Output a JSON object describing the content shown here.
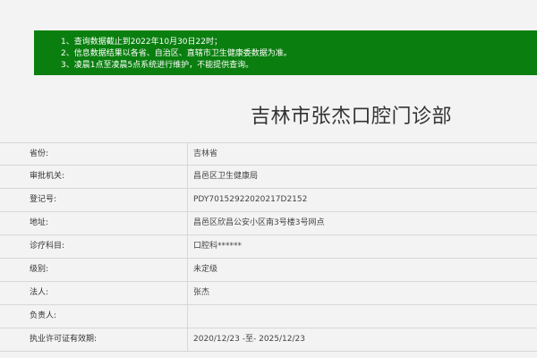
{
  "notice": {
    "lines": [
      "1、查询数据截止到2022年10月30日22时；",
      "2、信息数据结果以各省、自治区、直辖市卫生健康委数据为准。",
      "3、凌晨1点至凌晨5点系统进行维护，不能提供查询。"
    ]
  },
  "title": "吉林市张杰口腔门诊部",
  "rows": [
    {
      "label": "省份:",
      "value": "吉林省"
    },
    {
      "label": "审批机关:",
      "value": "昌邑区卫生健康局"
    },
    {
      "label": "登记号:",
      "value": "PDY70152922020217D2152"
    },
    {
      "label": "地址:",
      "value": "昌邑区欣昌公安小区南3号楼3号网点"
    },
    {
      "label": "诊疗科目:",
      "value": "口腔科******"
    },
    {
      "label": "级别:",
      "value": "未定级"
    },
    {
      "label": "法人:",
      "value": "张杰"
    },
    {
      "label": "负责人:",
      "value": ""
    },
    {
      "label": "执业许可证有效期:",
      "value": "2020/12/23 -至- 2025/12/23"
    }
  ]
}
